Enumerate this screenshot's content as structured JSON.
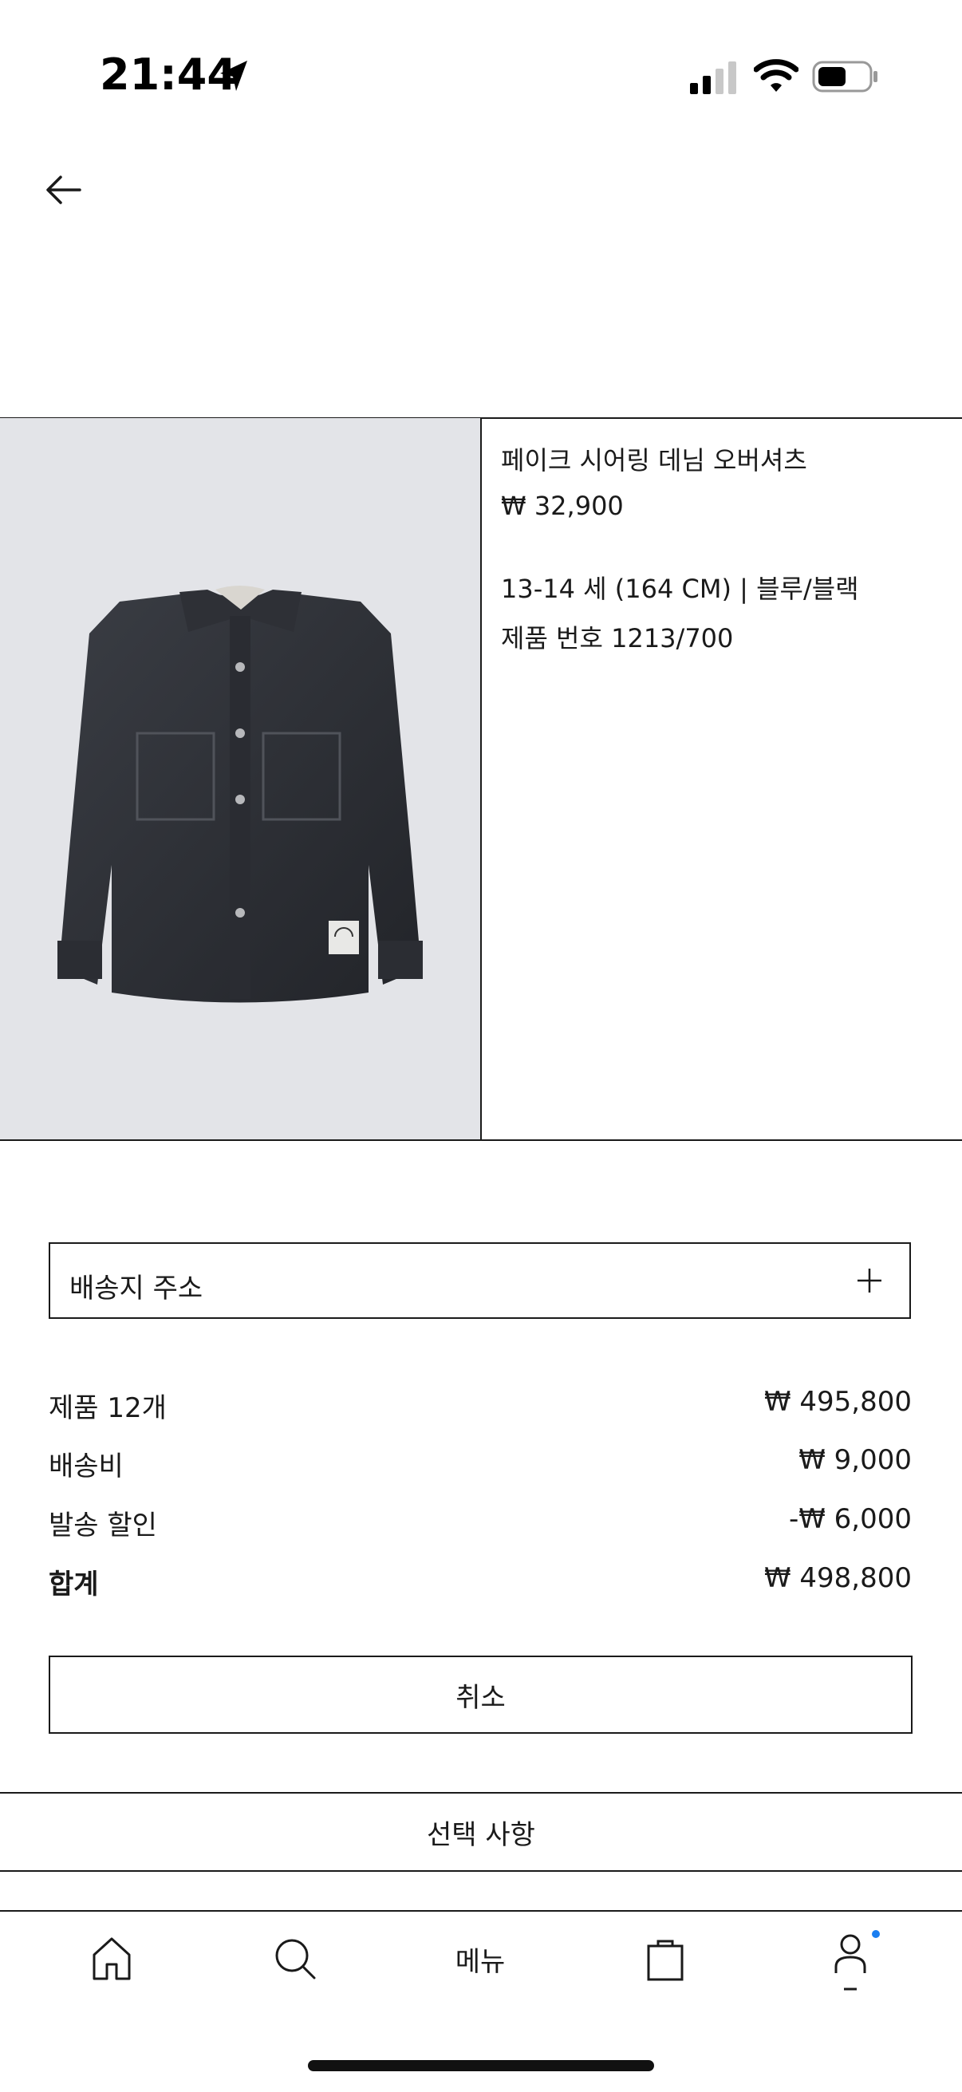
{
  "status_bar": {
    "time": "21:44"
  },
  "product": {
    "name": "페이크 시어링 데님 오버셔츠",
    "price": "₩ 32,900",
    "variant": "13-14 세 (164 CM) | 블루/블랙",
    "reference": "제품 번호 1213/700",
    "image_icon": "denim-overshirt-image"
  },
  "address": {
    "label": "배송지 주소"
  },
  "summary": {
    "rows": [
      {
        "label": "제품 12개",
        "value": "₩ 495,800"
      },
      {
        "label": "배송비",
        "value": "₩ 9,000"
      },
      {
        "label": "발송 할인",
        "value": "-₩ 6,000"
      },
      {
        "label": "합계",
        "value": "₩ 498,800"
      }
    ]
  },
  "actions": {
    "cancel_label": "취소",
    "options_label": "선택 사항"
  },
  "tab_bar": {
    "menu_label": "메뉴",
    "icons": [
      "home-icon",
      "search-icon",
      "bag-icon",
      "profile-icon"
    ]
  },
  "colors": {
    "text": "#1a1a1a",
    "image_bg": "#e3e4e8",
    "notification_dot": "#1a7ef0"
  }
}
